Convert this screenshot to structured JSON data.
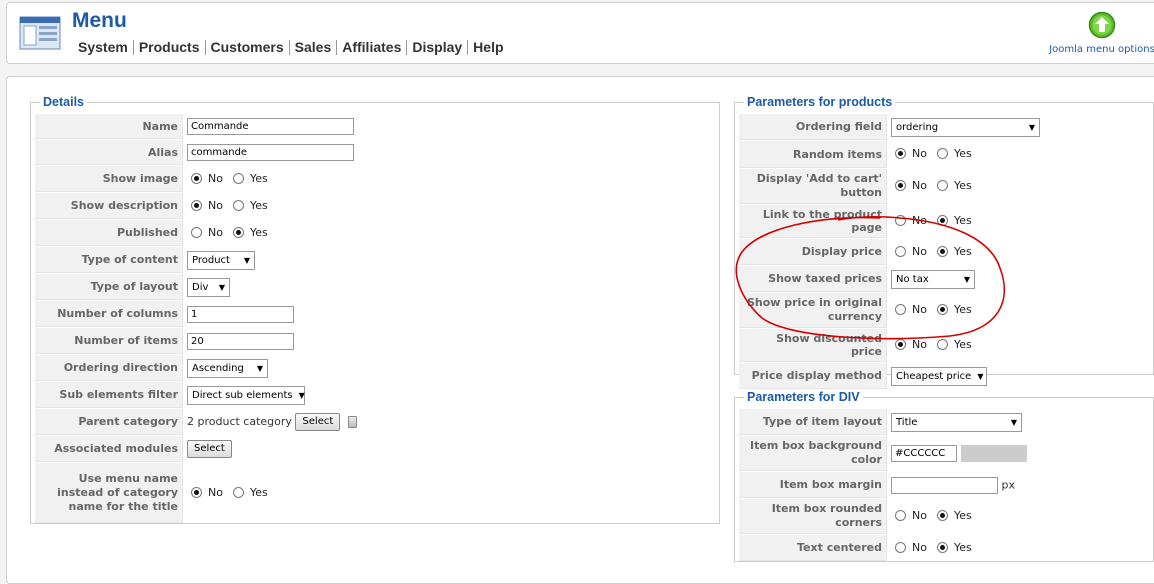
{
  "header": {
    "title": "Menu",
    "menu": [
      "System",
      "Products",
      "Customers",
      "Sales",
      "Affiliates",
      "Display",
      "Help"
    ],
    "options_label": "Joomla menu options",
    "options_icon": "green-up-arrow-icon",
    "app_icon": "menu-manager-icon"
  },
  "details": {
    "legend": "Details",
    "name_label": "Name",
    "name_value": "Commande",
    "alias_label": "Alias",
    "alias_value": "commande",
    "show_image_label": "Show image",
    "show_image": "No",
    "show_description_label": "Show description",
    "show_description": "No",
    "published_label": "Published",
    "published": "Yes",
    "type_content_label": "Type of content",
    "type_content_value": "Product",
    "type_layout_label": "Type of layout",
    "type_layout_value": "Div",
    "num_columns_label": "Number of columns",
    "num_columns_value": "1",
    "num_items_label": "Number of items",
    "num_items_value": "20",
    "ordering_dir_label": "Ordering direction",
    "ordering_dir_value": "Ascending",
    "sub_filter_label": "Sub elements filter",
    "sub_filter_value": "Direct sub elements",
    "parent_cat_label": "Parent category",
    "parent_cat_value": "2 product category",
    "select_label": "Select",
    "assoc_modules_label": "Associated modules",
    "assoc_select_label": "Select",
    "use_menu_name_label": "Use menu name instead of category name for the title",
    "use_menu_name": "No"
  },
  "products": {
    "legend": "Parameters for products",
    "ordering_field_label": "Ordering field",
    "ordering_field_value": "ordering",
    "random_items_label": "Random items",
    "random_items": "No",
    "add_to_cart_label": "Display 'Add to cart' button",
    "add_to_cart": "No",
    "link_product_label": "Link to the product page",
    "link_product": "Yes",
    "display_price_label": "Display price",
    "display_price": "Yes",
    "show_taxed_label": "Show taxed prices",
    "show_taxed_value": "No tax",
    "orig_currency_label": "Show price in original currency",
    "orig_currency": "Yes",
    "discounted_label": "Show discounted price",
    "discounted": "No",
    "price_method_label": "Price display method",
    "price_method_value": "Cheapest price"
  },
  "div": {
    "legend": "Parameters for DIV",
    "item_layout_label": "Type of item layout",
    "item_layout_value": "Title",
    "bg_color_label": "Item box background color",
    "bg_color_value": "#CCCCCC",
    "margin_label": "Item box margin",
    "margin_value": "",
    "margin_unit": "px",
    "rounded_label": "Item box rounded corners",
    "rounded": "Yes",
    "centered_label": "Text centered",
    "centered": "Yes"
  },
  "radio_labels": {
    "no": "No",
    "yes": "Yes"
  },
  "colors": {
    "accent": "#1c5aa8",
    "annotation": "#d40000",
    "swatch": "#cccccc"
  }
}
